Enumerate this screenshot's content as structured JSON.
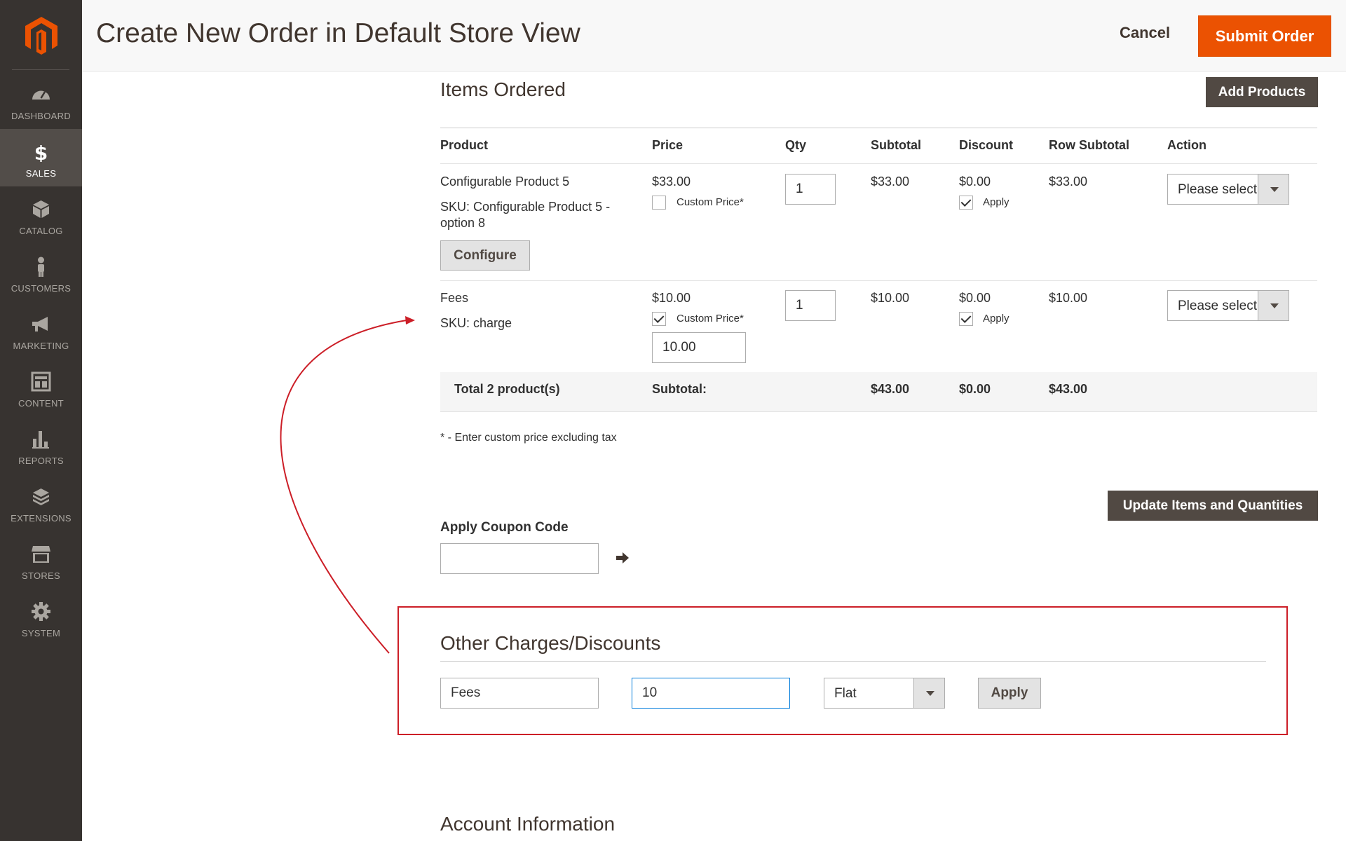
{
  "sidebar": {
    "items": [
      {
        "label": "DASHBOARD",
        "icon": "dashboard-icon"
      },
      {
        "label": "SALES",
        "icon": "dollar-icon",
        "active": true
      },
      {
        "label": "CATALOG",
        "icon": "cube-icon"
      },
      {
        "label": "CUSTOMERS",
        "icon": "person-icon"
      },
      {
        "label": "MARKETING",
        "icon": "megaphone-icon"
      },
      {
        "label": "CONTENT",
        "icon": "layout-icon"
      },
      {
        "label": "REPORTS",
        "icon": "bar-chart-icon"
      },
      {
        "label": "EXTENSIONS",
        "icon": "blocks-icon"
      },
      {
        "label": "STORES",
        "icon": "storefront-icon"
      },
      {
        "label": "SYSTEM",
        "icon": "gear-icon"
      }
    ]
  },
  "header": {
    "title": "Create New Order in Default Store View",
    "cancel_label": "Cancel",
    "submit_label": "Submit Order"
  },
  "items_ordered": {
    "title": "Items Ordered",
    "add_products_label": "Add Products",
    "columns": [
      "Product",
      "Price",
      "Qty",
      "Subtotal",
      "Discount",
      "Row Subtotal",
      "Action"
    ],
    "rows": [
      {
        "product": "Configurable Product 5",
        "sku": "SKU: Configurable Product 5 -",
        "sku_line2": "option 8",
        "configure_label": "Configure",
        "price": "$33.00",
        "custom_price_label": "Custom Price*",
        "custom_price_checked": false,
        "qty": "1",
        "subtotal": "$33.00",
        "discount": "$0.00",
        "apply_label": "Apply",
        "apply_checked": true,
        "row_subtotal": "$33.00",
        "action": "Please select"
      },
      {
        "product": "Fees",
        "sku": "SKU: charge",
        "price": "$10.00",
        "custom_price_label": "Custom Price*",
        "custom_price_checked": true,
        "custom_price_value": "10.00",
        "qty": "1",
        "subtotal": "$10.00",
        "discount": "$0.00",
        "apply_label": "Apply",
        "apply_checked": true,
        "row_subtotal": "$10.00",
        "action": "Please select"
      }
    ],
    "total": {
      "label": "Total 2 product(s)",
      "subtotal_label": "Subtotal:",
      "subtotal": "$43.00",
      "discount": "$0.00",
      "row_subtotal": "$43.00"
    },
    "note": "* - Enter custom price excluding tax",
    "update_label": "Update Items and Quantities"
  },
  "coupon": {
    "label": "Apply Coupon Code",
    "value": ""
  },
  "other_charges": {
    "title": "Other Charges/Discounts",
    "name_value": "Fees",
    "amount_value": "10",
    "type_value": "Flat",
    "apply_label": "Apply"
  },
  "account": {
    "title": "Account Information"
  },
  "colors": {
    "accent": "#eb5202",
    "sidebar": "#373330",
    "annotation": "#cc1e27"
  }
}
